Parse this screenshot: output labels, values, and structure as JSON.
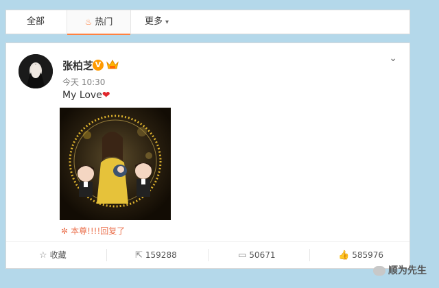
{
  "tabs": {
    "all": "全部",
    "hot": "热门",
    "more": "更多"
  },
  "post": {
    "username": "张柏芝",
    "verified_mark": "V",
    "time": "今天 10:30",
    "text": "My Love",
    "heart": "❤",
    "reply_text": "本尊!!!!回复了",
    "image_caption": "@..."
  },
  "actions": {
    "favorite": "收藏",
    "repost": "159288",
    "comment": "50671",
    "like": "585976"
  },
  "watermark": "顺为先生",
  "icons": {
    "hot": "fire-icon",
    "more": "chevron-down-icon",
    "favorite": "star-icon",
    "repost": "share-icon",
    "comment": "comment-icon",
    "like": "thumbs-up-icon"
  },
  "colors": {
    "accent": "#ff8140",
    "reply": "#eb7350",
    "verified": "#ff9a00",
    "background": "#b4d8ea"
  }
}
